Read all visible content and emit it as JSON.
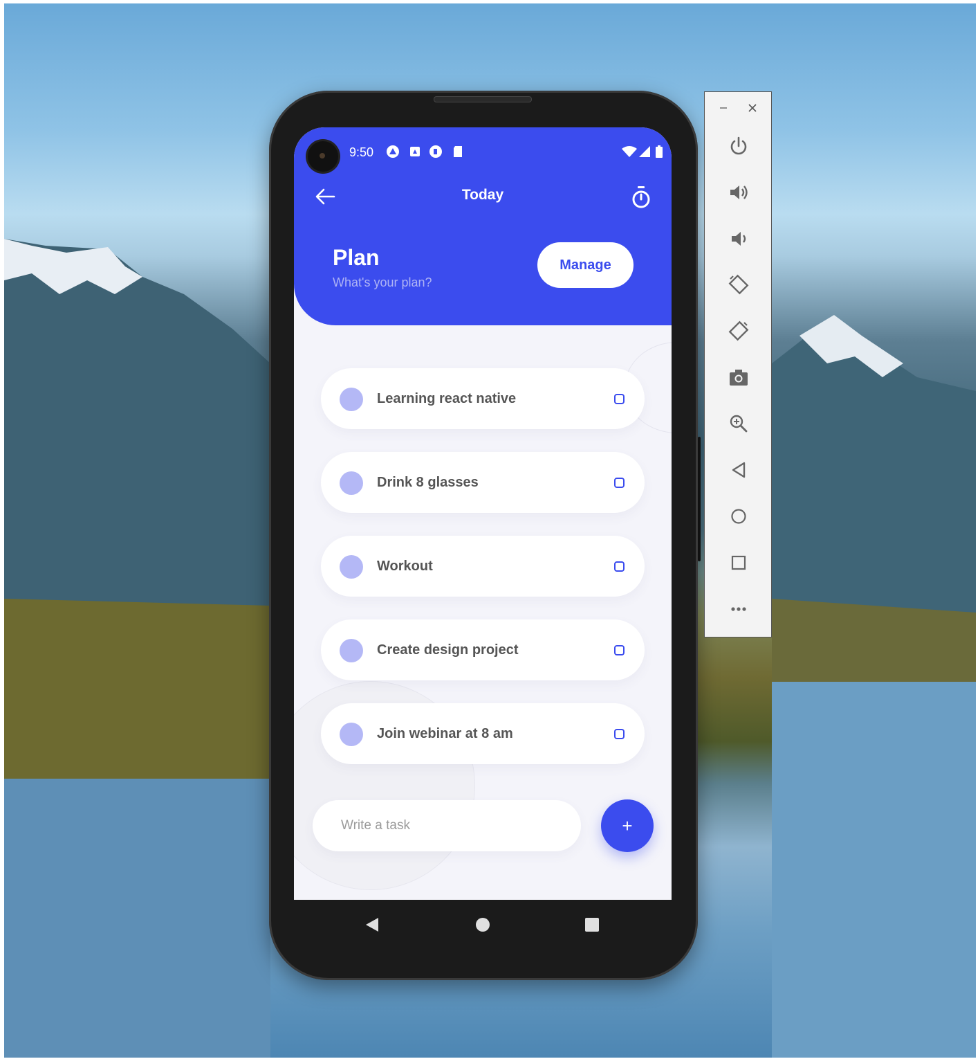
{
  "status_bar": {
    "time": "9:50"
  },
  "nav": {
    "title": "Today",
    "back_icon": "arrow-left-icon",
    "timer_icon": "stopwatch-icon"
  },
  "header": {
    "title": "Plan",
    "subtitle": "What's your plan?",
    "manage_label": "Manage"
  },
  "tasks": [
    {
      "label": "Learning react native"
    },
    {
      "label": "Drink 8 glasses"
    },
    {
      "label": "Workout"
    },
    {
      "label": "Create design project"
    },
    {
      "label": "Join webinar at 8 am"
    }
  ],
  "composer": {
    "placeholder": "Write a task",
    "add_label": "+"
  },
  "colors": {
    "accent": "#3b4cee",
    "task_dot": "#b4b8f6",
    "screen_bg": "#f4f4fa"
  },
  "emulator_toolbar": {
    "items": [
      "power-icon",
      "volume-up-icon",
      "volume-down-icon",
      "rotate-left-icon",
      "rotate-right-icon",
      "camera-icon",
      "zoom-icon",
      "back-icon",
      "home-icon",
      "overview-icon",
      "more-icon"
    ]
  }
}
